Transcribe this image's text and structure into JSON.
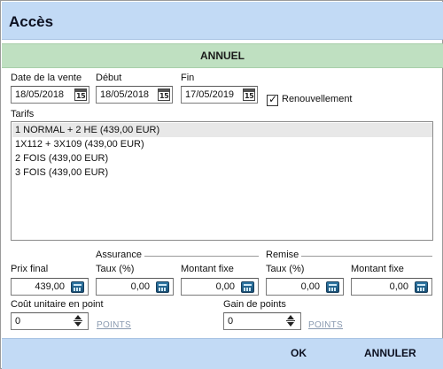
{
  "window": {
    "title": "Accès"
  },
  "banner": {
    "label": "ANNUEL"
  },
  "dates": {
    "sale_label": "Date de la vente",
    "sale_value": "18/05/2018",
    "start_label": "Début",
    "start_value": "18/05/2018",
    "end_label": "Fin",
    "end_value": "17/05/2019",
    "calendar_glyph": "15"
  },
  "renewal": {
    "label": "Renouvellement",
    "checked": true,
    "check_glyph": "✓"
  },
  "tarifs": {
    "label": "Tarifs",
    "items": [
      "1 NORMAL + 2 HE (439,00 EUR)",
      "1X112 + 3X109 (439,00 EUR)",
      "2 FOIS (439,00 EUR)",
      "3 FOIS (439,00 EUR)"
    ],
    "selected_index": 0
  },
  "pricing": {
    "final_price_label": "Prix final",
    "final_price_value": "439,00",
    "insurance_title": "Assurance",
    "insurance_rate_label": "Taux (%)",
    "insurance_rate_value": "0,00",
    "insurance_fixed_label": "Montant fixe",
    "insurance_fixed_value": "0,00",
    "discount_title": "Remise",
    "discount_rate_label": "Taux (%)",
    "discount_rate_value": "0,00",
    "discount_fixed_label": "Montant fixe",
    "discount_fixed_value": "0,00"
  },
  "points": {
    "unit_cost_label": "Coût unitaire en point",
    "unit_cost_value": "0",
    "unit_cost_link": "POINTS",
    "gain_label": "Gain de points",
    "gain_value": "0",
    "gain_link": "POINTS"
  },
  "footer": {
    "ok_label": "OK",
    "cancel_label": "ANNULER"
  },
  "colors": {
    "titlebar": "#c2daf5",
    "banner": "#bfe0c1",
    "selected_row": "#e8e8e8",
    "points_link": "#8a9ab0"
  }
}
